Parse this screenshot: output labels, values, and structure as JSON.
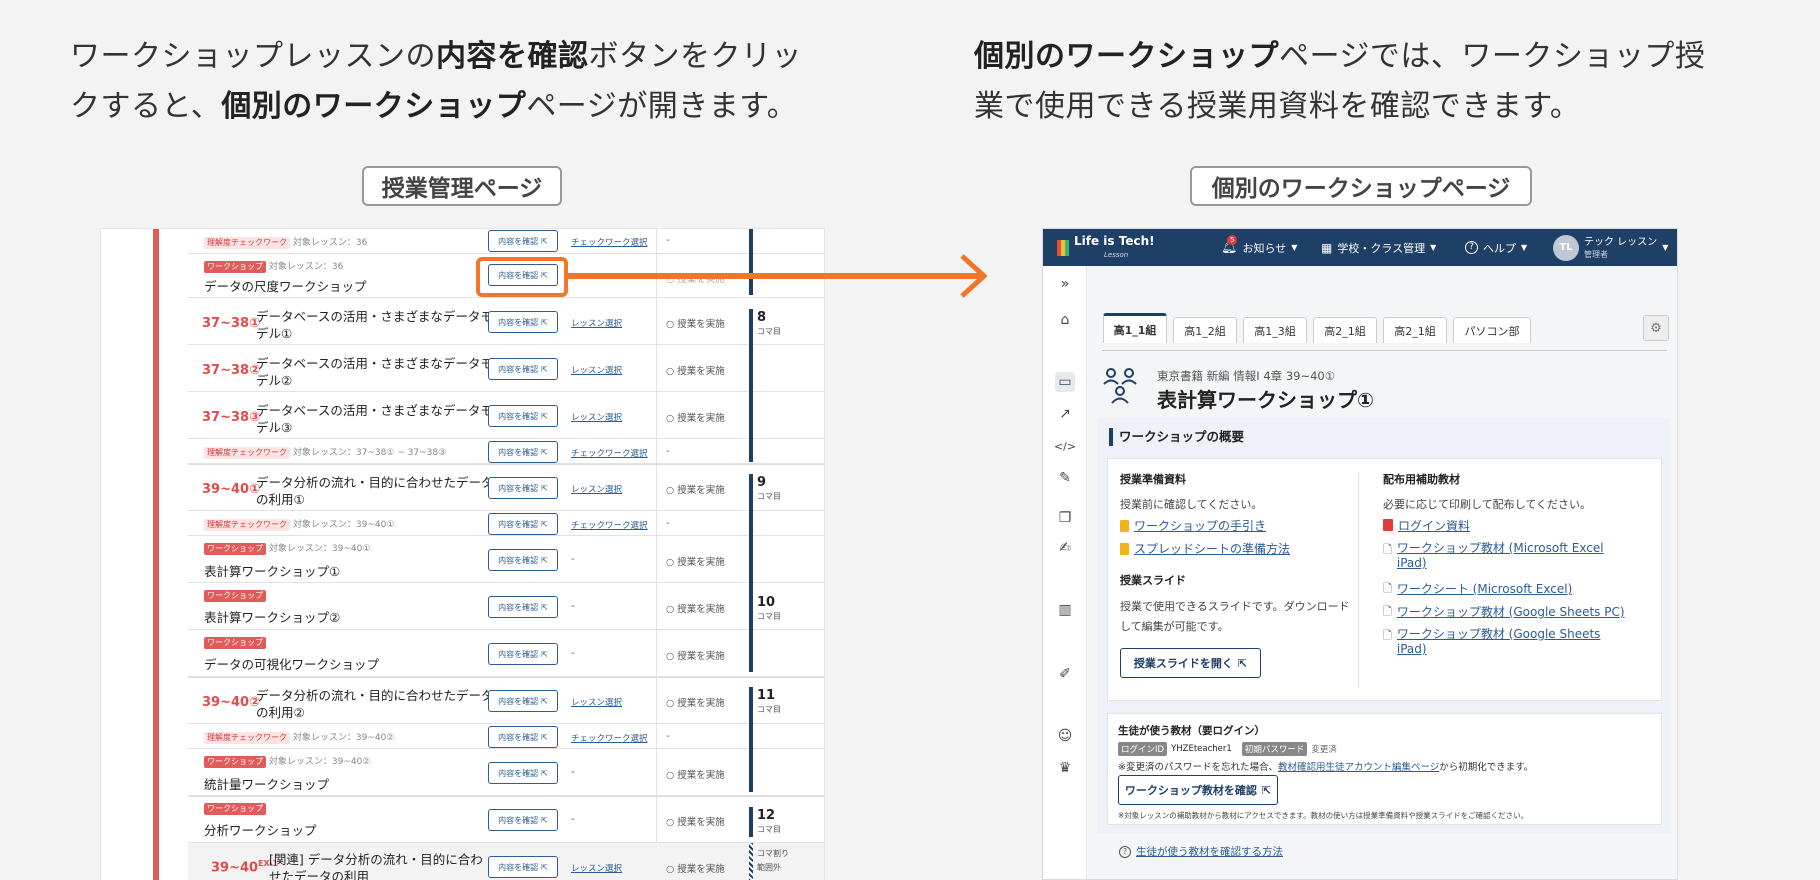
{
  "captions": {
    "left": {
      "line1_pre": "ワークショップレッスンの",
      "line1_bold": "内容を確認",
      "line1_post": "ボタンをクリッ",
      "line2_pre": "クすると、",
      "line2_bold": "個別のワークショップ",
      "line2_post": "ページが開きます。"
    },
    "right": {
      "line1_bold": "個別のワークショップ",
      "line1_post": "ページでは、ワークショップ授",
      "line2": "業で使用できる授業用資料を確認できます。"
    }
  },
  "tags": {
    "left": "授業管理ページ",
    "right": "個別のワークショップページ"
  },
  "colors": {
    "accent_orange": "#f0772a",
    "navy": "#1e3f66",
    "red": "#e25b5b",
    "link": "#2c5d94"
  },
  "left_panel": {
    "btn_label": "内容を確認",
    "rows": [
      {
        "badge": "理解度チェックワーク",
        "target": "対象レッスン：36",
        "link": "チェックワーク選択",
        "status": "-"
      },
      {
        "badge": "ワークショップ",
        "target": "対象レッスン：36",
        "title": "データの尺度ワークショップ",
        "status": "○ 授業を実施"
      },
      {
        "num": "37~38①",
        "title": "データベースの活用・さまざまなデータモデル①",
        "link": "レッスン選択",
        "status": "○ 授業を実施",
        "koma": "8",
        "koma_label": "コマ目"
      },
      {
        "num": "37~38②",
        "title": "データベースの活用・さまざまなデータモデル②",
        "link": "レッスン選択",
        "status": "○ 授業を実施"
      },
      {
        "num": "37~38③",
        "title": "データベースの活用・さまざまなデータモデル③",
        "link": "レッスン選択",
        "status": "○ 授業を実施"
      },
      {
        "badge": "理解度チェックワーク",
        "target": "対象レッスン：37~38① ~ 37~38③",
        "link": "チェックワーク選択",
        "status": "-"
      },
      {
        "num": "39~40①",
        "title": "データ分析の流れ・目的に合わせたデータの利用①",
        "link": "レッスン選択",
        "status": "○ 授業を実施",
        "koma": "9",
        "koma_label": "コマ目"
      },
      {
        "badge": "理解度チェックワーク",
        "target": "対象レッスン：39~40①",
        "link": "チェックワーク選択",
        "status": "-"
      },
      {
        "badge": "ワークショップ",
        "target": "対象レッスン：39~40①",
        "title": "表計算ワークショップ①",
        "dash": "-",
        "status": "○ 授業を実施"
      },
      {
        "badge": "ワークショップ",
        "title": "表計算ワークショップ②",
        "dash": "-",
        "status": "○ 授業を実施",
        "koma": "10",
        "koma_label": "コマ目"
      },
      {
        "badge": "ワークショップ",
        "title": "データの可視化ワークショップ",
        "dash": "-",
        "status": "○ 授業を実施"
      },
      {
        "num": "39~40②",
        "title": "データ分析の流れ・目的に合わせたデータの利用②",
        "link": "レッスン選択",
        "status": "○ 授業を実施",
        "koma": "11",
        "koma_label": "コマ目"
      },
      {
        "badge": "理解度チェックワーク",
        "target": "対象レッスン：39~40②",
        "link": "チェックワーク選択",
        "status": "-"
      },
      {
        "badge": "ワークショップ",
        "target": "対象レッスン：39~40②",
        "title": "統計量ワークショップ",
        "dash": "-",
        "status": "○ 授業を実施"
      },
      {
        "badge": "ワークショップ",
        "title": "分析ワークショップ",
        "dash": "-",
        "status": "○ 授業を実施",
        "koma": "12",
        "koma_label": "コマ目"
      },
      {
        "num": "39~40",
        "num_sup": "EX-1",
        "title": "[関連] データ分析の流れ・目的に合わせたデータの利用",
        "link": "レッスン選択",
        "status": "○ 授業を実施",
        "koma_label": "コマ割り範囲外"
      }
    ]
  },
  "right_panel": {
    "header": {
      "logo": "Life is Tech!",
      "logo_sub": "Lesson",
      "notification_count": "5",
      "notifications": "お知らせ",
      "school": "学校・クラス管理",
      "help": "ヘルプ",
      "avatar": "TL",
      "user_name": "テック レッスン",
      "user_role": "管理者"
    },
    "tabs": [
      "高1_1組",
      "高1_2組",
      "高1_3組",
      "高2_1組",
      "高2_1組",
      "パソコン部"
    ],
    "breadcrumb": "東京書籍 新編 情報Ⅰ 4章 39~40①",
    "page_title": "表計算ワークショップ①",
    "overview_title": "ワークショップの概要",
    "prep": {
      "title": "授業準備資料",
      "desc": "授業前に確認してください。",
      "links": [
        "ワークショップの手引き",
        "スプレッドシートの準備方法"
      ]
    },
    "slides": {
      "title": "授業スライド",
      "desc1": "授業で使用できるスライドです。ダウンロード",
      "desc2": "して編集が可能です。",
      "button": "授業スライドを開く"
    },
    "handouts": {
      "title": "配布用補助教材",
      "desc": "必要に応じて印刷して配布してください。",
      "links": [
        {
          "line1": "ログイン資料",
          "line2": ""
        },
        {
          "line1": "ワークショップ教材 (Microsoft Excel",
          "line2": "iPad)"
        },
        {
          "line1": "ワークシート (Microsoft Excel)",
          "line2": ""
        },
        {
          "line1": "ワークショップ教材 (Google Sheets PC)",
          "line2": ""
        },
        {
          "line1": "ワークショップ教材 (Google Sheets",
          "line2": "iPad)"
        }
      ]
    },
    "student": {
      "title": "生徒が使う教材（要ログイン）",
      "login_id_label": "ログインID",
      "login_id": "YHZEteacher1",
      "pw_label": "初期パスワード",
      "pw_value": "変更済",
      "note_pre": "※変更済のパスワードを忘れた場合、",
      "note_link": "教材確認用生徒アカウント編集ページ",
      "note_post": "から初期化できます。",
      "button": "ワークショップ教材を確認",
      "note2": "※対象レッスンの補助教材から教材にアクセスできます。教材の使い方は授業準備資料や授業スライドをご確認ください。",
      "help_link": "生徒が使う教材を確認する方法"
    }
  }
}
